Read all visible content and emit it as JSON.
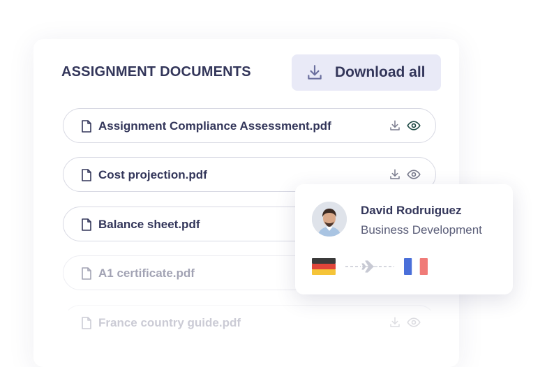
{
  "section": {
    "title": "ASSIGNMENT DOCUMENTS",
    "download_all_label": "Download all"
  },
  "documents": [
    {
      "name": "Assignment Compliance Assessment.pdf",
      "view_active": true
    },
    {
      "name": "Cost projection.pdf",
      "view_active": false
    },
    {
      "name": "Balance sheet.pdf",
      "view_active": false
    },
    {
      "name": "A1 certificate.pdf",
      "view_active": false
    },
    {
      "name": "France country guide.pdf",
      "view_active": false
    }
  ],
  "contact_card": {
    "name": "David Rodruiguez",
    "role": "Business Development",
    "from_flag": "germany-flag",
    "to_flag": "france-flag",
    "route_icon": "airplane-icon"
  },
  "colors": {
    "text_primary": "#33365a",
    "button_bg": "#e9eaf7",
    "active_eye": "#1f4a45",
    "accent_icon": "#6b6f9e"
  }
}
